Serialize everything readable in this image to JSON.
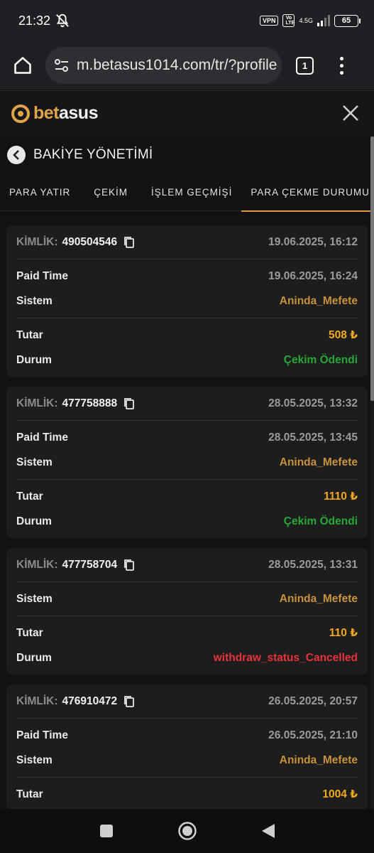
{
  "status_bar": {
    "time": "21:32",
    "vpn_label": "VPN",
    "volte_label": "Vo LTE",
    "network_label": "4.5G",
    "battery_level": "65"
  },
  "browser": {
    "url": "m.betasus1014.com/tr/?profile",
    "tab_count": "1"
  },
  "site": {
    "logo_part1": "bet",
    "logo_part2": "asus",
    "section_title": "BAKİYE YÖNETİMİ"
  },
  "tabs": [
    {
      "label": "PARA YATIR",
      "active": false
    },
    {
      "label": "ÇEKİM",
      "active": false
    },
    {
      "label": "İŞLEM GEÇMİŞİ",
      "active": false
    },
    {
      "label": "PARA ÇEKME DURUMU",
      "active": true
    }
  ],
  "labels": {
    "id": "KİMLİK:",
    "paid_time": "Paid Time",
    "system": "Sistem",
    "amount": "Tutar",
    "status": "Durum"
  },
  "transactions": [
    {
      "id": "490504546",
      "date": "19.06.2025, 16:12",
      "paid_time": "19.06.2025, 16:24",
      "system": "Aninda_Mefete",
      "amount": "508 ₺",
      "status": "Çekim Ödendi",
      "status_color": "#27a836"
    },
    {
      "id": "477758888",
      "date": "28.05.2025, 13:32",
      "paid_time": "28.05.2025, 13:45",
      "system": "Aninda_Mefete",
      "amount": "1110 ₺",
      "status": "Çekim Ödendi",
      "status_color": "#27a836"
    },
    {
      "id": "477758704",
      "date": "28.05.2025, 13:31",
      "system": "Aninda_Mefete",
      "amount": "110 ₺",
      "status": "withdraw_status_Cancelled",
      "status_color": "#e8323c"
    },
    {
      "id": "476910472",
      "date": "26.05.2025, 20:57",
      "paid_time": "26.05.2025, 21:10",
      "system": "Aninda_Mefete",
      "amount": "1004 ₺"
    }
  ],
  "colors": {
    "accent": "#d99a3f",
    "system_text": "#c8913c",
    "amount_text": "#f3a91d",
    "paid": "#27a836",
    "cancelled": "#e8323c"
  }
}
